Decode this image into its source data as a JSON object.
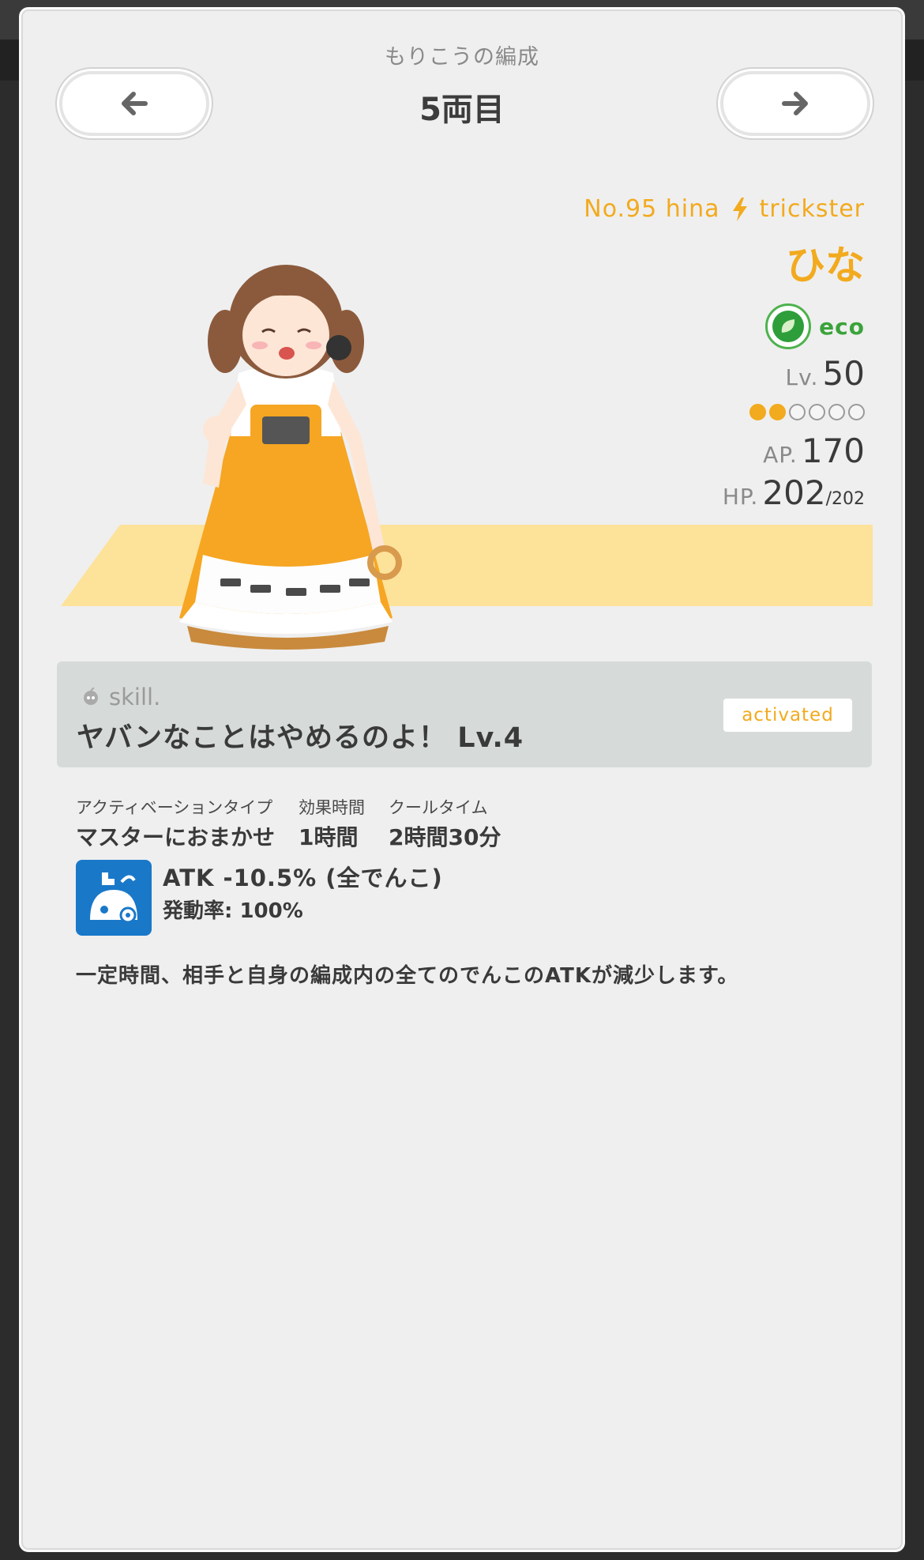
{
  "header": {
    "subtitle": "もりこうの編成",
    "title": "5両目",
    "prev_icon": "arrow-left-icon",
    "next_icon": "arrow-right-icon"
  },
  "character": {
    "number": "No.95 hina",
    "type_icon": "lightning-icon",
    "type": "trickster",
    "name": "ひな",
    "attribute": "eco",
    "level_label": "Lv.",
    "level": "50",
    "rank_filled": 2,
    "rank_total": 6,
    "ap_label": "AP.",
    "ap": "170",
    "hp_label": "HP.",
    "hp": "202",
    "hp_max": "/202",
    "colors": {
      "accent": "#f2aa1e",
      "eco": "#2e9e3a",
      "floor": "#fde29a"
    }
  },
  "skill": {
    "tag": "skill.",
    "name": "ヤバンなことはやめるのよ！ Lv.4",
    "status": "activated",
    "info": [
      {
        "head": "アクティベーションタイプ",
        "value": "マスターにおまかせ"
      },
      {
        "head": "効果時間",
        "value": "1時間"
      },
      {
        "head": "クールタイム",
        "value": "2時間30分"
      }
    ],
    "effect_main": "ATK -10.5% (全でんこ)",
    "effect_rate": "発動率: 100%",
    "description": "一定時間、相手と自身の編成内の全てのでんこのATKが減少します。"
  }
}
